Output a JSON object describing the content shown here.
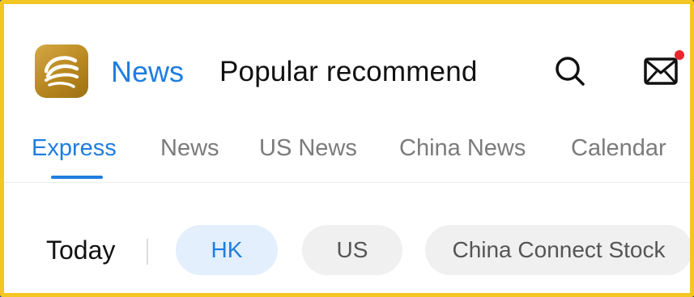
{
  "header": {
    "logo_icon": "golden-swirl-logo-icon",
    "title": "News",
    "search_text": "Popular recommend",
    "search_icon": "search-icon",
    "mail_icon": "mail-icon",
    "mail_badge": true
  },
  "tabs": [
    {
      "label": "Express",
      "active": true
    },
    {
      "label": "News",
      "active": false
    },
    {
      "label": "US News",
      "active": false
    },
    {
      "label": "China News",
      "active": false
    },
    {
      "label": "Calendar",
      "active": false
    }
  ],
  "filters": {
    "today_label": "Today",
    "chips": [
      {
        "label": "HK",
        "active": true
      },
      {
        "label": "US",
        "active": false
      },
      {
        "label": "China Connect Stock",
        "active": false
      }
    ]
  },
  "colors": {
    "accent": "#1f7de0",
    "frame_border": "#f3c623",
    "badge": "#e8262d",
    "logo_gold": "#c0922a"
  }
}
